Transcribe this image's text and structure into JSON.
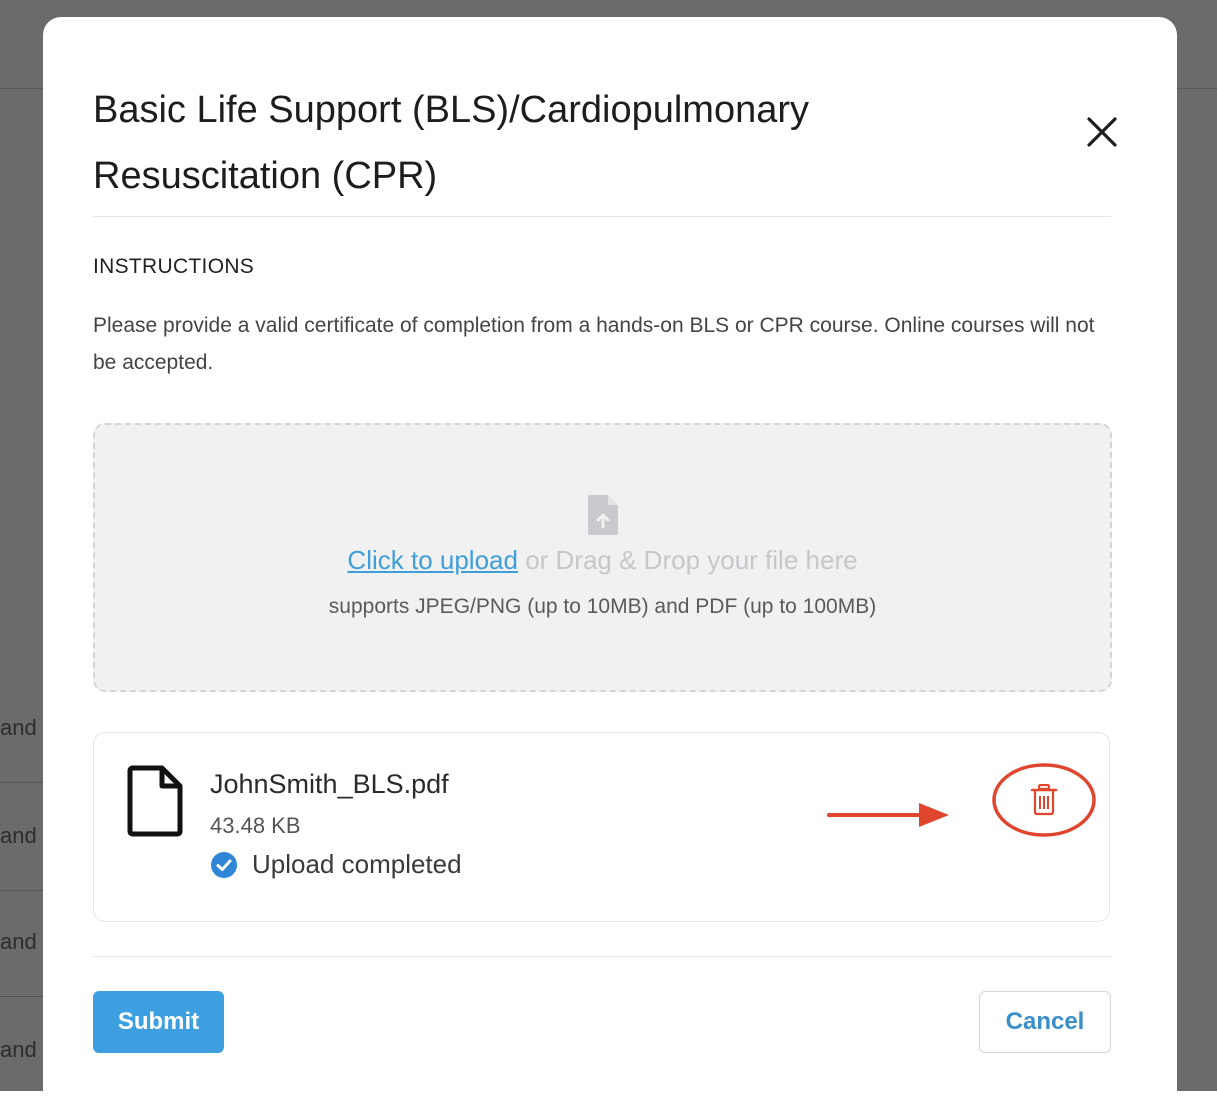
{
  "background": {
    "row_fragments": [
      "and",
      "and",
      "and",
      "and"
    ]
  },
  "modal": {
    "title": "Basic Life Support (BLS)/Cardiopulmonary Resuscitation (CPR)",
    "close_icon": "close-icon",
    "instructions_label": "INSTRUCTIONS",
    "instructions_text": "Please provide a valid certificate of completion from a hands-on BLS or CPR course. Online courses will not be accepted.",
    "upload": {
      "link_text": "Click to upload",
      "drag_text": " or Drag & Drop your file here",
      "supports_text": "supports JPEG/PNG (up to 10MB) and PDF (up to 100MB)",
      "icon": "file-upload-icon"
    },
    "file": {
      "name": "JohnSmith_BLS.pdf",
      "size": "43.48 KB",
      "status": "Upload completed",
      "icon": "document-icon",
      "status_icon": "check-circle-icon",
      "delete_icon": "trash-icon"
    },
    "annotation": {
      "arrow_color": "#e0462e",
      "circle_color": "#e0462e"
    },
    "buttons": {
      "submit": "Submit",
      "cancel": "Cancel"
    }
  },
  "colors": {
    "primary": "#3d9fe0",
    "link": "#3f9ed8",
    "danger": "#e0462e"
  }
}
